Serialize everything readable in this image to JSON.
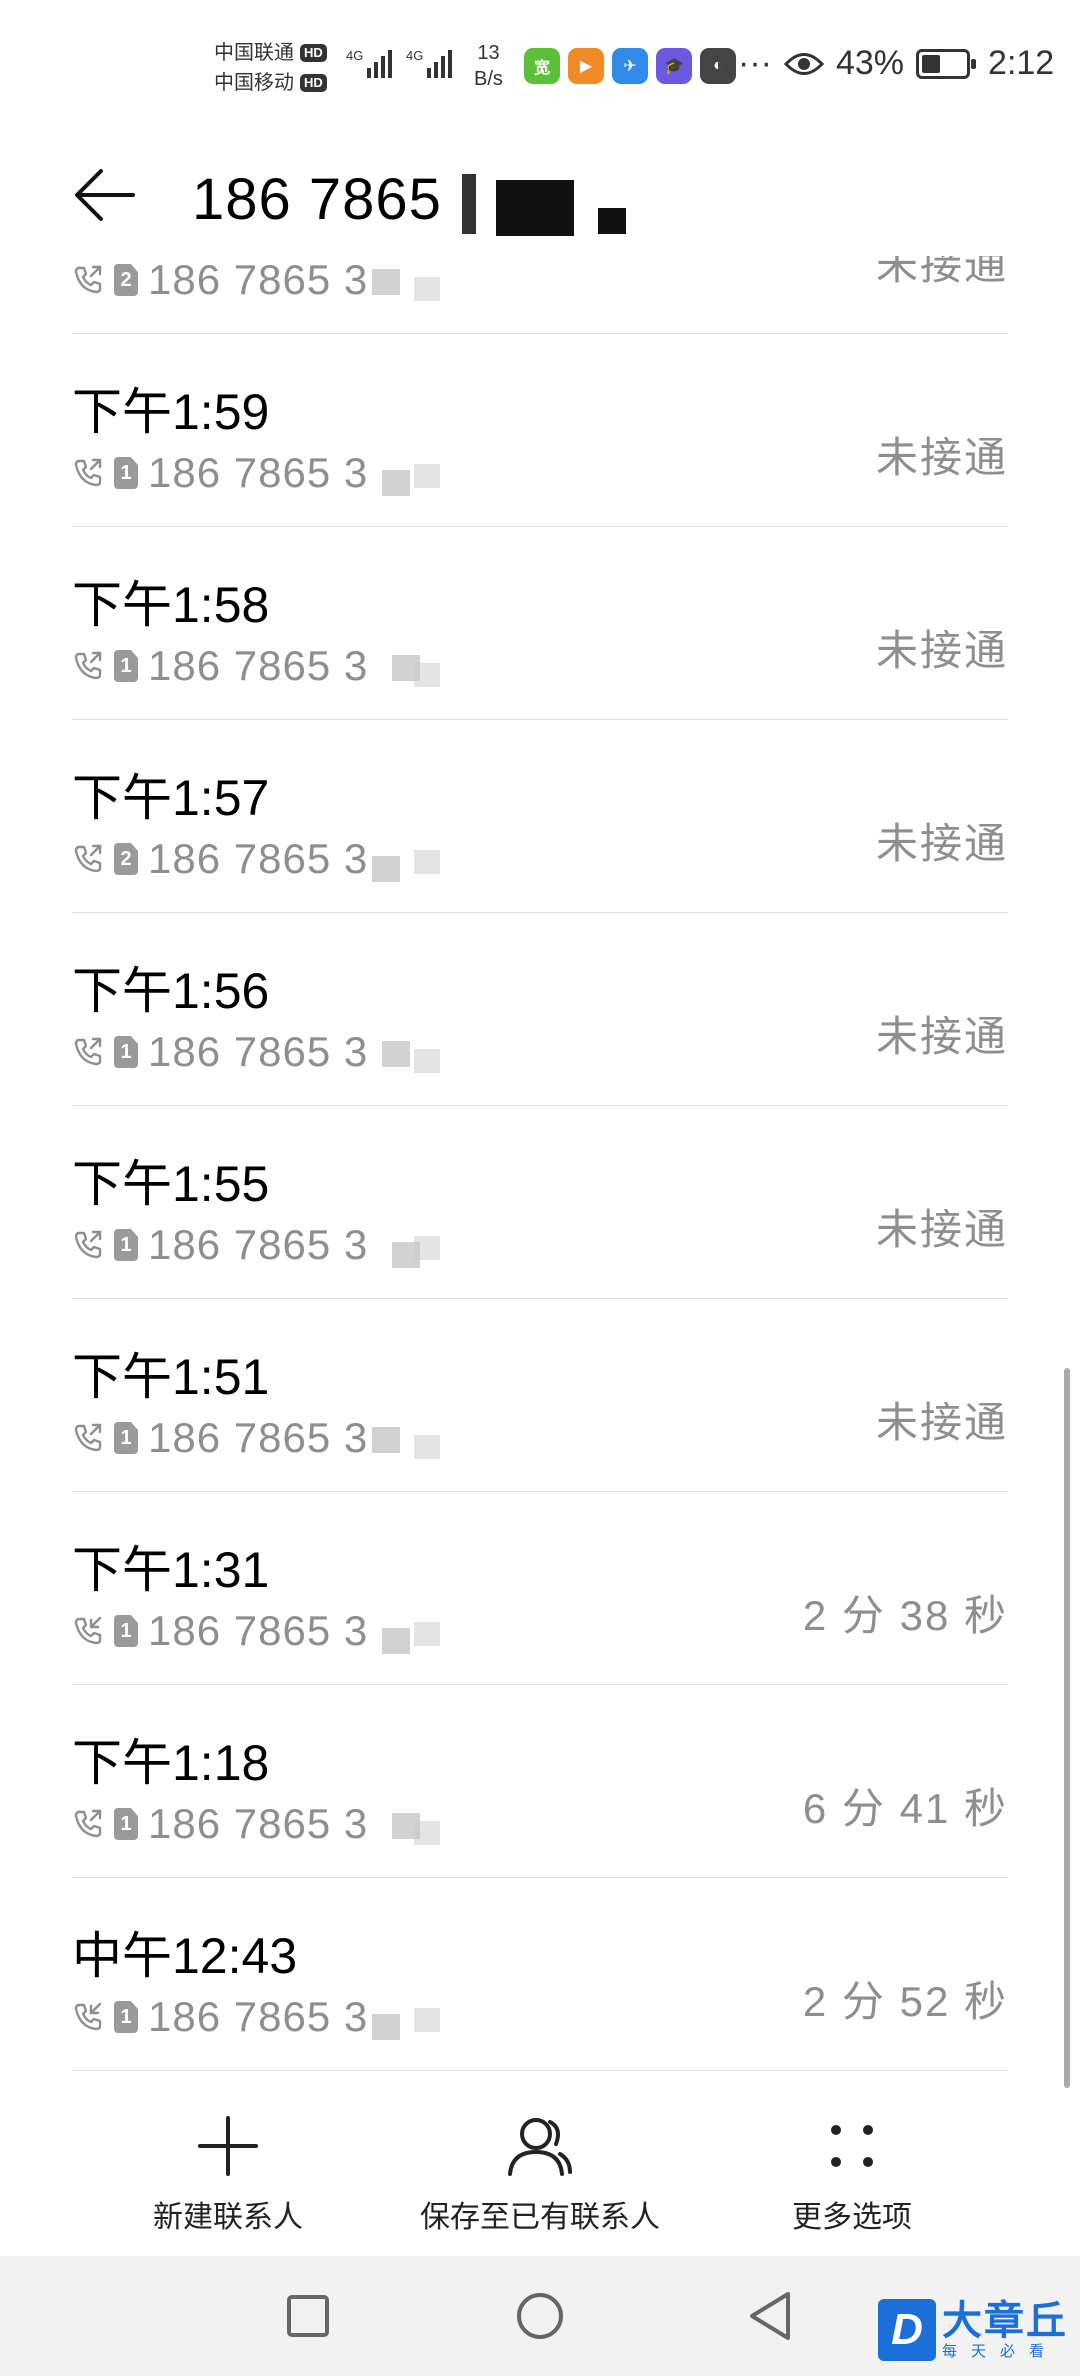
{
  "status_bar": {
    "carrier_1": "中国联通",
    "carrier_2": "中国移动",
    "hd_label": "HD",
    "network_type_1": "4G",
    "network_type_2": "4G",
    "net_speed_value": "13",
    "net_speed_unit": "B/s",
    "more_icons": "···",
    "battery_percent": "43%",
    "battery_level": 0.43,
    "time": "2:12",
    "app_icons": [
      {
        "name": "wifi-assistant-app-icon",
        "color": "#5cbf3a",
        "glyph": "宽"
      },
      {
        "name": "video-app-icon",
        "color": "#f08a24",
        "glyph": "▶"
      },
      {
        "name": "bird-app-icon",
        "color": "#2f8ae8",
        "glyph": "✈"
      },
      {
        "name": "education-app-icon",
        "color": "#6a5ae0",
        "glyph": "🎓"
      },
      {
        "name": "globe-app-icon",
        "color": "#444444",
        "glyph": "◐"
      }
    ]
  },
  "header": {
    "title": "186 7865"
  },
  "call_list": [
    {
      "time": "",
      "sim": "2",
      "number": "186 7865 3",
      "status": "未接通",
      "direction": "outgoing"
    },
    {
      "time": "下午1:59",
      "sim": "1",
      "number": "186 7865 3",
      "status": "未接通",
      "direction": "outgoing"
    },
    {
      "time": "下午1:58",
      "sim": "1",
      "number": "186 7865 3",
      "status": "未接通",
      "direction": "outgoing"
    },
    {
      "time": "下午1:57",
      "sim": "2",
      "number": "186 7865 3",
      "status": "未接通",
      "direction": "outgoing"
    },
    {
      "time": "下午1:56",
      "sim": "1",
      "number": "186 7865 3",
      "status": "未接通",
      "direction": "outgoing"
    },
    {
      "time": "下午1:55",
      "sim": "1",
      "number": "186 7865 3",
      "status": "未接通",
      "direction": "outgoing"
    },
    {
      "time": "下午1:51",
      "sim": "1",
      "number": "186 7865 3",
      "status": "未接通",
      "direction": "outgoing"
    },
    {
      "time": "下午1:31",
      "sim": "1",
      "number": "186 7865 3",
      "status": "2 分 38 秒",
      "direction": "incoming"
    },
    {
      "time": "下午1:18",
      "sim": "1",
      "number": "186 7865 3",
      "status": "6 分 41 秒",
      "direction": "outgoing"
    },
    {
      "time": "中午12:43",
      "sim": "1",
      "number": "186 7865 3",
      "status": "2 分 52 秒",
      "direction": "incoming"
    }
  ],
  "actions": {
    "new_contact": "新建联系人",
    "save_existing": "保存至已有联系人",
    "more_options": "更多选项"
  },
  "watermark": {
    "logo": "D",
    "name": "大章丘",
    "slogan": "每天必看"
  }
}
